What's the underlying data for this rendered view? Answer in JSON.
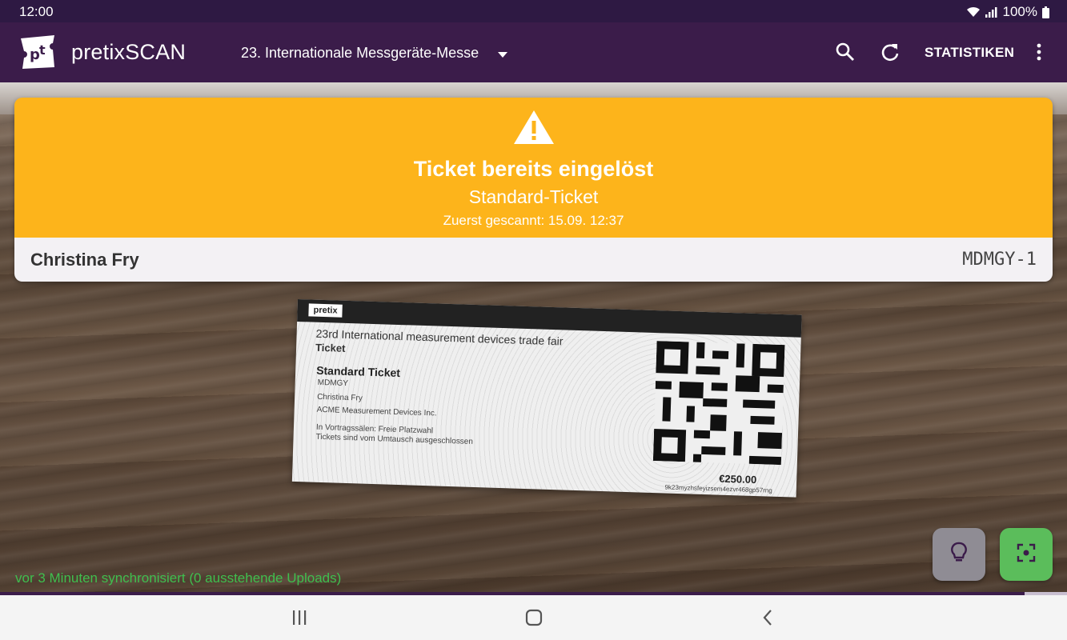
{
  "status_bar": {
    "time": "12:00",
    "battery": "100%"
  },
  "app_bar": {
    "title": "pretixSCAN",
    "event_name": "23. Internationale Messgeräte-Messe",
    "stats_label": "STATISTIKEN",
    "icons": [
      "search-icon",
      "refresh-icon",
      "more-vert-icon"
    ]
  },
  "result": {
    "title": "Ticket bereits eingelöst",
    "ticket_type": "Standard-Ticket",
    "first_scanned": "Zuerst gescannt: 15.09. 12:37",
    "attendee_name": "Christina Fry",
    "order_code": "MDMGY-1",
    "color": "#fdb41b"
  },
  "ticket_preview": {
    "logo": "pretix",
    "event": "23rd International measurement devices trade fair",
    "label": "Ticket",
    "type": "Standard Ticket",
    "code": "MDMGY",
    "name": "Christina Fry",
    "company": "ACME Measurement Devices Inc.",
    "note1": "In Vortragssälen: Freie Platzwahl",
    "note2": "Tickets sind vom Umtausch ausgeschlossen",
    "price": "€250.00",
    "secret": "9k23myzhsfeyizsem4ezvr468gp57rng"
  },
  "sync_status": "vor 3 Minuten synchronisiert (0 ausstehende Uploads)",
  "progress_fraction": 0.96,
  "fabs": [
    "lightbulb-icon",
    "focus-scan-icon"
  ],
  "nav_bar": [
    "recents-icon",
    "home-icon",
    "back-icon"
  ],
  "colors": {
    "primary": "#3b1c4a",
    "warning": "#fdb41b",
    "success": "#5bbd5b",
    "sync_text": "#3fbf4e"
  }
}
